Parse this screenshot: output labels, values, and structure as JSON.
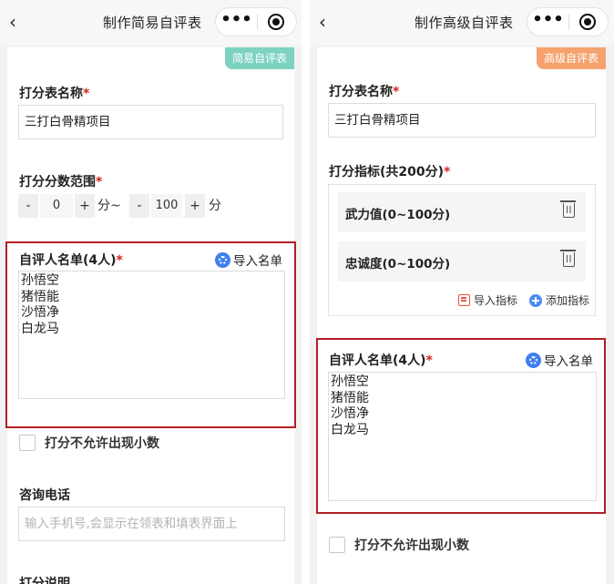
{
  "left": {
    "nav_title": "制作简易自评表",
    "badge": "简易自评表",
    "name_label": "打分表名称",
    "name_value": "三打白骨精项目",
    "range_label": "打分分数范围",
    "range": {
      "minus": "-",
      "plus": "+",
      "min_value": "0",
      "unit_from": "分~",
      "max_value": "100",
      "unit_to": "分"
    },
    "list_label": "自评人名单(4人)",
    "import_label": "导入名单",
    "names": [
      "孙悟空",
      "猪悟能",
      "沙悟净",
      "白龙马"
    ],
    "decimal_label": "打分不允许出现小数",
    "phone_label": "咨询电话",
    "phone_placeholder": "输入手机号,会显示在领表和填表界面上",
    "desc_label": "打分说明"
  },
  "right": {
    "nav_title": "制作高级自评表",
    "badge": "高级自评表",
    "name_label": "打分表名称",
    "name_value": "三打白骨精项目",
    "indicators_label": "打分指标(共200分)",
    "indicators": [
      "武力值(0~100分)",
      "忠诚度(0~100分)"
    ],
    "import_indicators": "导入指标",
    "add_indicator": "添加指标",
    "list_label": "自评人名单(4人)",
    "import_label": "导入名单",
    "names": [
      "孙悟空",
      "猪悟能",
      "沙悟净",
      "白龙马"
    ],
    "decimal_label": "打分不允许出现小数"
  },
  "required_mark": "*",
  "nav": {
    "back_icon": "‹",
    "more_icon": "•••"
  },
  "colors": {
    "highlight": "#b31f24",
    "badge_simple": "#7dd3c0",
    "badge_advanced": "#f6a26e",
    "required": "#d9241c",
    "accent_blue": "#3f7ff0"
  }
}
